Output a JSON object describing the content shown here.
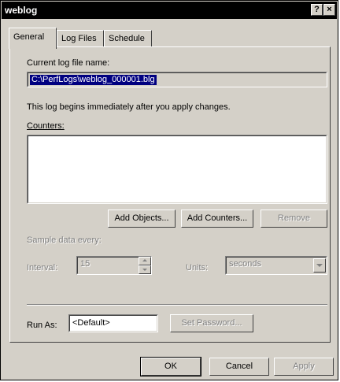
{
  "window": {
    "title": "weblog",
    "help_button": "?",
    "close_button": "×"
  },
  "tabs": [
    {
      "label": "General",
      "active": true
    },
    {
      "label": "Log Files",
      "active": false
    },
    {
      "label": "Schedule",
      "active": false
    }
  ],
  "general": {
    "current_log_label": "Current log file name:",
    "current_log_value": "C:\\PerfLogs\\weblog_000001.blg",
    "info_text": "This log begins immediately after you apply changes.",
    "counters_label": "Counters:",
    "add_objects_label": "Add Objects...",
    "add_counters_label": "Add Counters...",
    "remove_label": "Remove",
    "sample_label": "Sample data every:",
    "interval_label": "Interval:",
    "interval_value": "15",
    "units_label": "Units:",
    "units_value": "seconds",
    "run_as_label": "Run As:",
    "run_as_value": "<Default>",
    "set_password_label": "Set Password..."
  },
  "footer": {
    "ok_label": "OK",
    "cancel_label": "Cancel",
    "apply_label": "Apply"
  }
}
